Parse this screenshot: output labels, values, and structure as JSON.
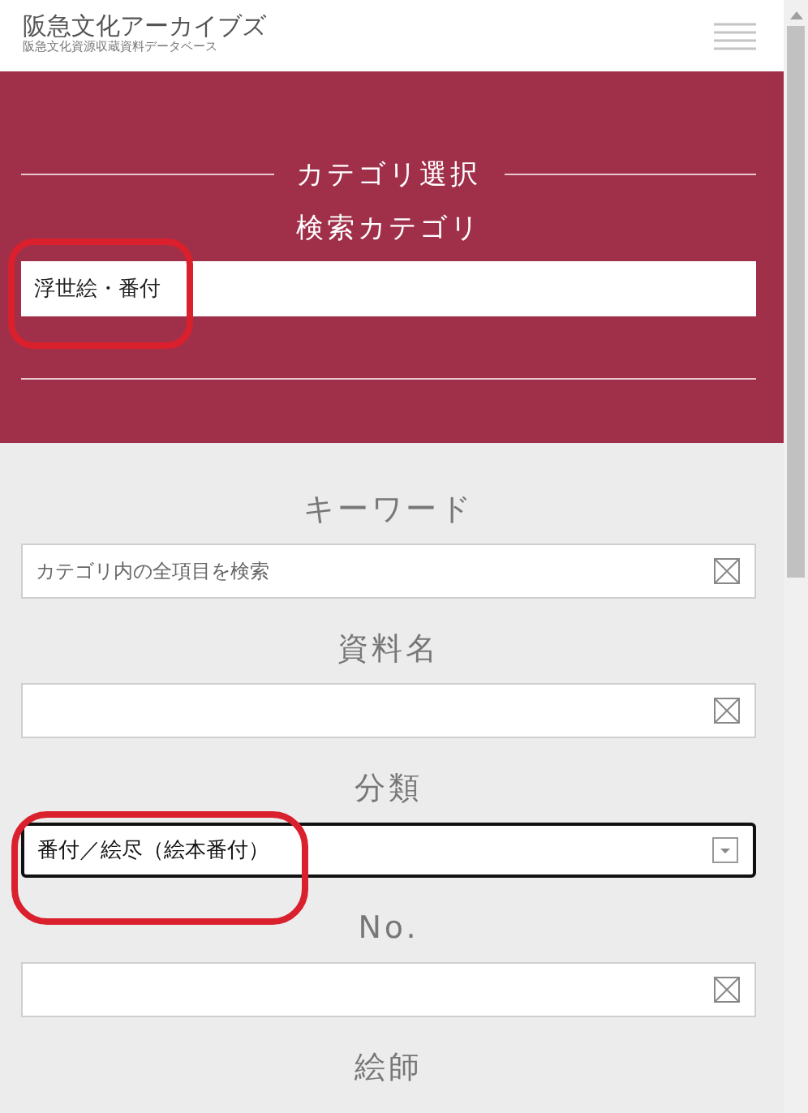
{
  "header": {
    "logo": "阪急文化アーカイブズ",
    "subtitle": "阪急文化資源収蔵資料データベース"
  },
  "category": {
    "heading": "カテゴリ選択",
    "label": "検索カテゴリ",
    "value": "浮世絵・番付"
  },
  "fields": [
    {
      "label": "キーワード",
      "kind": "text",
      "placeholder": "カテゴリ内の全項目を検索"
    },
    {
      "label": "資料名",
      "kind": "text"
    },
    {
      "label": "分類",
      "kind": "select",
      "value": "番付／絵尽（絵本番付）",
      "focused": true
    },
    {
      "label": "No.",
      "kind": "text"
    },
    {
      "label": "絵師",
      "kind": "label_only"
    }
  ]
}
